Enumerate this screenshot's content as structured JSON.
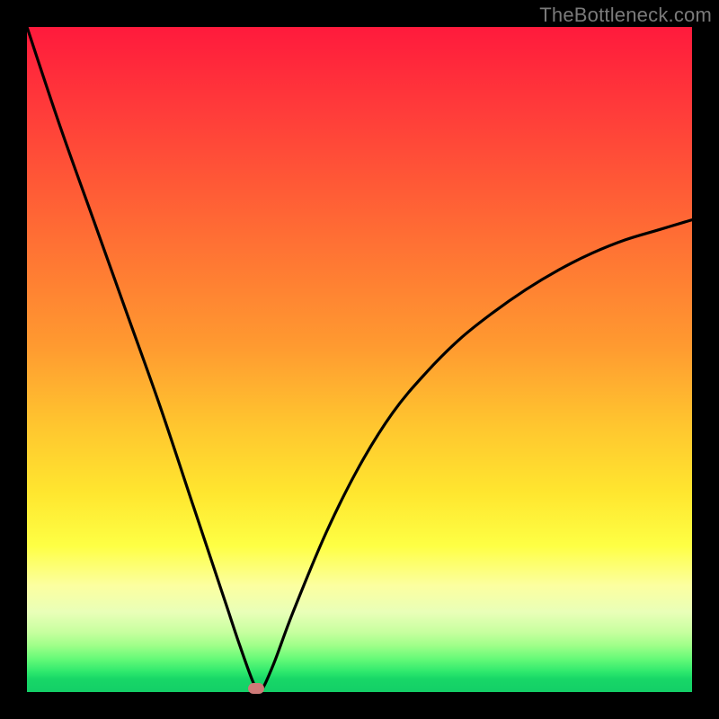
{
  "watermark": "TheBottleneck.com",
  "colors": {
    "frame": "#000000",
    "curve": "#000000",
    "marker": "#cf7a78",
    "gradient_top": "#ff1a3c",
    "gradient_bottom": "#13cf67"
  },
  "chart_data": {
    "type": "line",
    "title": "",
    "xlabel": "",
    "ylabel": "",
    "xlim": [
      0,
      100
    ],
    "ylim": [
      0,
      100
    ],
    "series": [
      {
        "name": "bottleneck-curve",
        "x": [
          0,
          5,
          10,
          15,
          20,
          25,
          28,
          30,
          32,
          34,
          35,
          37,
          40,
          45,
          50,
          55,
          60,
          65,
          70,
          75,
          80,
          85,
          90,
          95,
          100
        ],
        "values": [
          100,
          85,
          71,
          57,
          43,
          28,
          19,
          13,
          7,
          1.5,
          0,
          4,
          12,
          24,
          34,
          42,
          48,
          53,
          57,
          60.5,
          63.5,
          66,
          68,
          69.5,
          71
        ]
      }
    ],
    "annotations": [
      {
        "name": "minimum-marker",
        "x": 34.5,
        "y": 0.6
      }
    ]
  }
}
